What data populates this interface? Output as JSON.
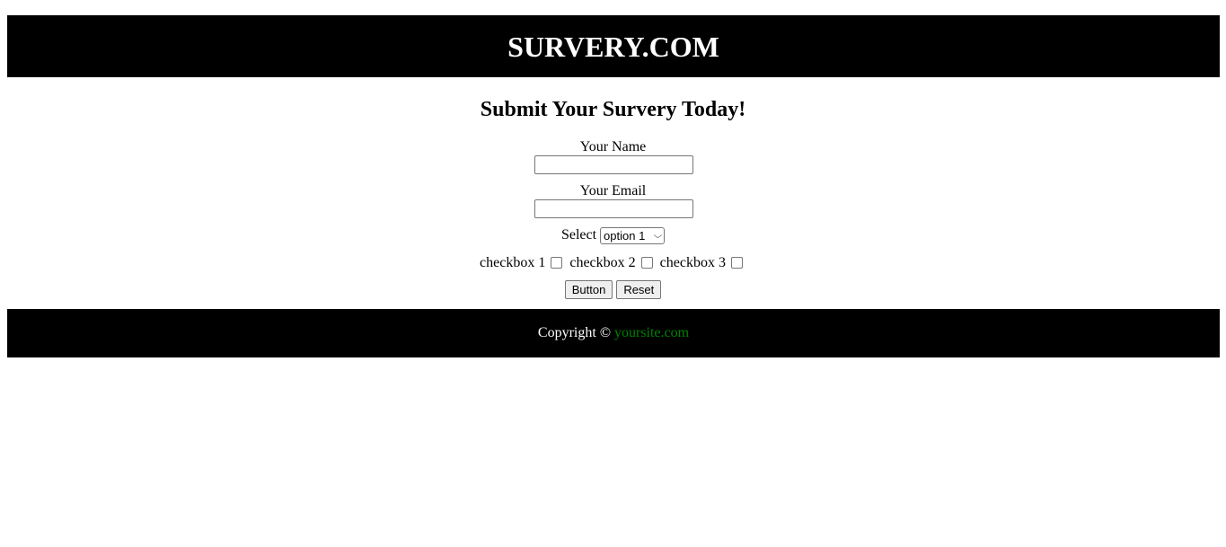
{
  "header": {
    "title": "SURVERY.COM"
  },
  "form": {
    "title": "Submit Your Survery Today!",
    "name_label": "Your Name",
    "name_value": "",
    "email_label": "Your Email",
    "email_value": "",
    "select_label": "Select",
    "select_value": "option 1",
    "checkboxes": [
      {
        "label": "checkbox 1",
        "checked": false
      },
      {
        "label": "checkbox 2",
        "checked": false
      },
      {
        "label": "checkbox 3",
        "checked": false
      }
    ],
    "button_label": "Button",
    "reset_label": "Reset"
  },
  "footer": {
    "copyright_text": "Copyright ©",
    "link_text": "yoursite.com"
  },
  "colors": {
    "header_bg": "#000000",
    "footer_bg": "#000000",
    "link": "#008000"
  }
}
